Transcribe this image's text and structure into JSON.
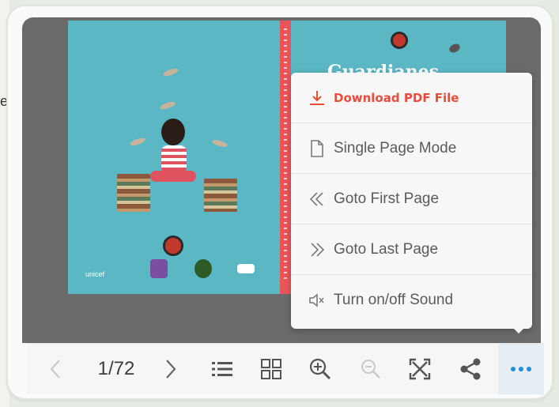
{
  "edge_text": "e",
  "book": {
    "cover_title": "Guardianes",
    "publisher": "unicef"
  },
  "menu": {
    "items": [
      {
        "label": "Download PDF File",
        "icon": "download-icon"
      },
      {
        "label": "Single Page Mode",
        "icon": "single-page-icon"
      },
      {
        "label": "Goto First Page",
        "icon": "double-chevron-left-icon"
      },
      {
        "label": "Goto Last Page",
        "icon": "double-chevron-right-icon"
      },
      {
        "label": "Turn on/off Sound",
        "icon": "speaker-icon"
      }
    ]
  },
  "toolbar": {
    "page_counter": "1/72",
    "buttons": [
      "prev-page",
      "next-page",
      "table-of-contents",
      "thumbnails",
      "zoom-in",
      "zoom-out",
      "fullscreen",
      "share",
      "more"
    ]
  },
  "colors": {
    "accent": "#e74c3c",
    "cover": "#5ab7c3",
    "spine": "#e9565a",
    "more_active": "#1e8fd5"
  }
}
